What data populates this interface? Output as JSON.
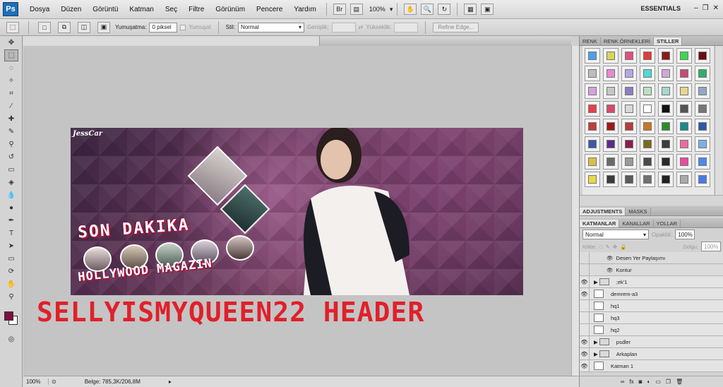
{
  "app": {
    "logo": "Ps",
    "workspace": "ESSENTIALS",
    "zoom": "100%"
  },
  "menu": [
    "Dosya",
    "Düzen",
    "Görüntü",
    "Katman",
    "Seç",
    "Filtre",
    "Görünüm",
    "Pencere",
    "Yardım"
  ],
  "options": {
    "feather_label": "Yumuşatma:",
    "feather_value": "0 piksel",
    "antialias_label": "Yumuşat",
    "style_label": "Stil:",
    "style_value": "Normal",
    "width_label": "Genişlik:",
    "height_label": "Yükseklik:",
    "refine_label": "Refine Edge..."
  },
  "status": {
    "zoom": "100%",
    "doc": "Belge: 785,3K/206,8M"
  },
  "banner": {
    "creator": "JessCar",
    "headline": "SON DAKIKA",
    "subline": "HOLLYWOOD MAGAZIN"
  },
  "caption": "SELLYISMYQUEEN22 HEADER",
  "panels": {
    "tabs": [
      "RENK",
      "RENK ÖRNEKLERİ",
      "STILLER"
    ],
    "adj_tabs": [
      "ADJUSTMENTS",
      "MASKS"
    ],
    "layer_tabs": [
      "KATMANLAR",
      "KANALLAR",
      "YOLLAR"
    ],
    "blend": "Normal",
    "opacity_label": "Opaklık:",
    "opacity": "100%",
    "lock_label": "Kilitle:",
    "fill_label": "Dolgu:",
    "fill": "100%"
  },
  "layers": [
    {
      "name": "Desen Yer Paylaşımı",
      "type": "effect",
      "visible": true
    },
    {
      "name": "Kontur",
      "type": "effect",
      "visible": true
    },
    {
      "name": ";ek'1",
      "type": "group",
      "visible": true
    },
    {
      "name": "demrem-a3",
      "type": "layer",
      "visible": true
    },
    {
      "name": "hq1",
      "type": "layer",
      "visible": false
    },
    {
      "name": "hq3",
      "type": "layer",
      "visible": false
    },
    {
      "name": "hq2",
      "type": "layer",
      "visible": false
    },
    {
      "name": "psdler",
      "type": "group",
      "visible": true
    },
    {
      "name": "Arkaplan",
      "type": "group",
      "visible": true
    },
    {
      "name": "Katman 1",
      "type": "layer",
      "visible": true
    }
  ],
  "colors": {
    "fg": "#7a1040",
    "bg": "#ffffff",
    "caption": "#e0202a"
  }
}
